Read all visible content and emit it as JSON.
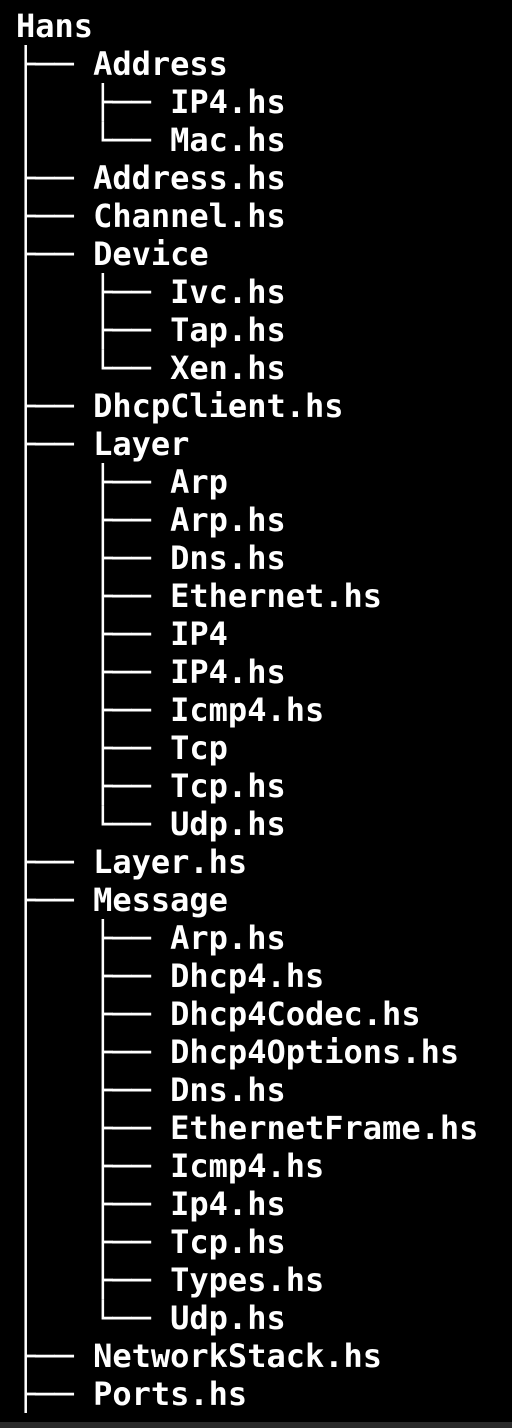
{
  "colors": {
    "background": "#000000",
    "text": "#ffffff"
  },
  "tree": [
    {
      "prefix": "",
      "name": "Hans"
    },
    {
      "prefix": "├── ",
      "name": "Address"
    },
    {
      "prefix": "│   ├── ",
      "name": "IP4.hs"
    },
    {
      "prefix": "│   └── ",
      "name": "Mac.hs"
    },
    {
      "prefix": "├── ",
      "name": "Address.hs"
    },
    {
      "prefix": "├── ",
      "name": "Channel.hs"
    },
    {
      "prefix": "├── ",
      "name": "Device"
    },
    {
      "prefix": "│   ├── ",
      "name": "Ivc.hs"
    },
    {
      "prefix": "│   ├── ",
      "name": "Tap.hs"
    },
    {
      "prefix": "│   └── ",
      "name": "Xen.hs"
    },
    {
      "prefix": "├── ",
      "name": "DhcpClient.hs"
    },
    {
      "prefix": "├── ",
      "name": "Layer"
    },
    {
      "prefix": "│   ├── ",
      "name": "Arp"
    },
    {
      "prefix": "│   ├── ",
      "name": "Arp.hs"
    },
    {
      "prefix": "│   ├── ",
      "name": "Dns.hs"
    },
    {
      "prefix": "│   ├── ",
      "name": "Ethernet.hs"
    },
    {
      "prefix": "│   ├── ",
      "name": "IP4"
    },
    {
      "prefix": "│   ├── ",
      "name": "IP4.hs"
    },
    {
      "prefix": "│   ├── ",
      "name": "Icmp4.hs"
    },
    {
      "prefix": "│   ├── ",
      "name": "Tcp"
    },
    {
      "prefix": "│   ├── ",
      "name": "Tcp.hs"
    },
    {
      "prefix": "│   └── ",
      "name": "Udp.hs"
    },
    {
      "prefix": "├── ",
      "name": "Layer.hs"
    },
    {
      "prefix": "├── ",
      "name": "Message"
    },
    {
      "prefix": "│   ├── ",
      "name": "Arp.hs"
    },
    {
      "prefix": "│   ├── ",
      "name": "Dhcp4.hs"
    },
    {
      "prefix": "│   ├── ",
      "name": "Dhcp4Codec.hs"
    },
    {
      "prefix": "│   ├── ",
      "name": "Dhcp4Options.hs"
    },
    {
      "prefix": "│   ├── ",
      "name": "Dns.hs"
    },
    {
      "prefix": "│   ├── ",
      "name": "EthernetFrame.hs"
    },
    {
      "prefix": "│   ├── ",
      "name": "Icmp4.hs"
    },
    {
      "prefix": "│   ├── ",
      "name": "Ip4.hs"
    },
    {
      "prefix": "│   ├── ",
      "name": "Tcp.hs"
    },
    {
      "prefix": "│   ├── ",
      "name": "Types.hs"
    },
    {
      "prefix": "│   └── ",
      "name": "Udp.hs"
    },
    {
      "prefix": "├── ",
      "name": "NetworkStack.hs"
    },
    {
      "prefix": "├── ",
      "name": "Ports.hs"
    }
  ]
}
